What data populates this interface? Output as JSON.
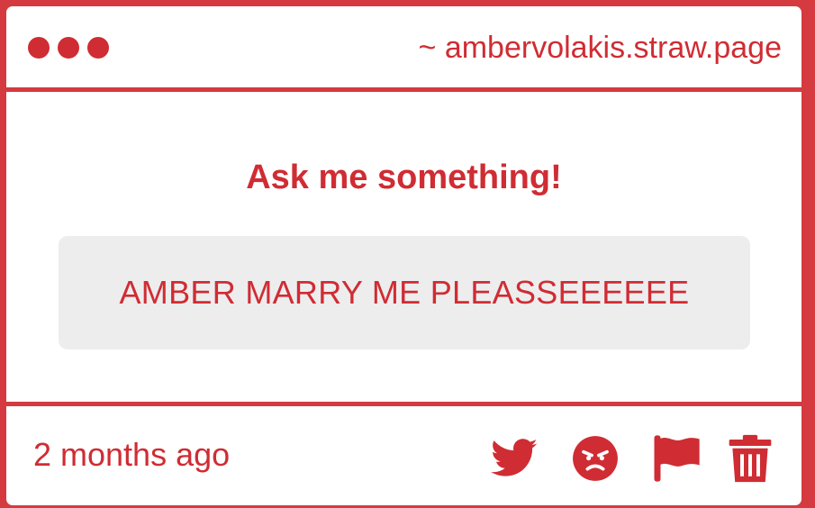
{
  "window": {
    "url": "~ ambervolakis.straw.page"
  },
  "card": {
    "prompt": "Ask me something!",
    "question": "AMBER MARRY ME PLEASSEEEEEE",
    "timestamp": "2 months ago"
  },
  "icons": {
    "share": "twitter-icon",
    "react": "angry-face-icon",
    "report": "flag-icon",
    "delete": "trash-icon"
  },
  "colors": {
    "accent": "#d02c33",
    "border": "#d43a3f",
    "question_bg": "#ededee"
  }
}
